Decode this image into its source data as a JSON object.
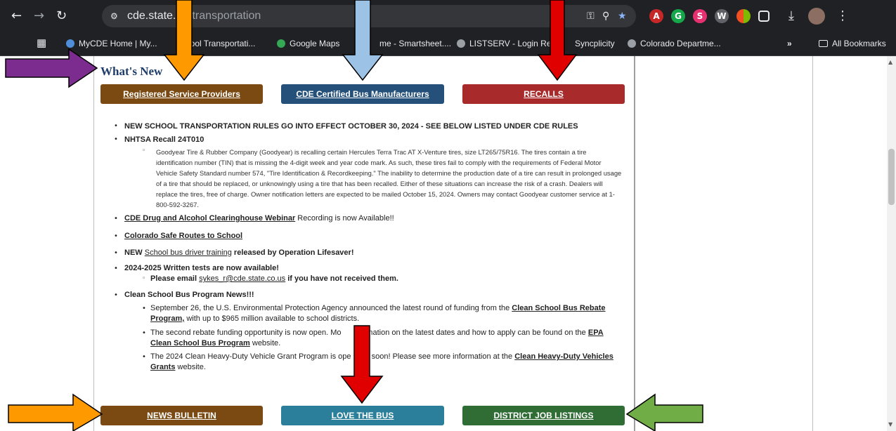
{
  "browser": {
    "url_host": "cde.state.co",
    "url_path": "/transportation",
    "bookmarks": [
      "MyCDE Home | My...",
      "chool Transportati...",
      "Google Maps",
      "me - Smartsheet....",
      "LISTSERV - Login Re...",
      "Syncplicity",
      "Colorado Departme..."
    ],
    "more_label": "»",
    "all_bookmarks": "All Bookmarks"
  },
  "section": {
    "title": "What's New"
  },
  "top_buttons": {
    "service_providers": "Registered Service Providers",
    "bus_manufacturers": "CDE Certified Bus Manufacturers",
    "recalls": "RECALLS"
  },
  "news": {
    "item1": "NEW SCHOOL TRANSPORTATION RULES GO INTO EFFECT OCTOBER 30, 2024 - SEE BELOW LISTED UNDER CDE RULES",
    "item2_title": "NHTSA Recall 24T010",
    "recall_text": "Goodyear Tire & Rubber Company (Goodyear) is recalling certain Hercules Terra Trac AT X-Venture tires, size LT265/75R16. The tires contain a tire identification number (TIN) that is missing the 4-digit week and year code mark. As such, these tires fail to comply with the requirements of Federal Motor Vehicle Safety Standard number 574, \"Tire Identification & Recordkeeping.\" The inability to determine the production date of a tire can result in prolonged usage of a tire that should be replaced, or unknowingly using a tire that has been recalled. Either of these situations can increase the risk of a crash. Dealers will replace the tires, free of charge. Owner notification letters are expected to be mailed October 15, 2024. Owners may contact Goodyear customer service at 1-800-592-3267.",
    "item3_link": "CDE Drug and Alcohol Clearinghouse Webinar",
    "item3_rest": " Recording is now Available!!",
    "item4_link": "Colorado Safe Routes to School",
    "item5_pre": "NEW ",
    "item5_link": "School bus driver training",
    "item5_rest": " released by Operation Lifesaver!",
    "item6": "2024-2025 Written tests are now available!",
    "item6_sub_pre": "Please email ",
    "item6_sub_link": "sykes_r@cde.state.co.us",
    "item6_sub_rest": " if you have not received them.",
    "item7": "Clean School Bus Program News!!!",
    "csb1_pre": "September 26, the U.S. Environmental Protection Agency announced the latest round of funding from the ",
    "csb1_link_a": "Clean School Bus Rebate",
    "csb1_link_b": "Program,",
    "csb1_rest": " with up to $965 million available to school districts.",
    "csb2_pre": "The second rebate funding opportunity is now open. Mo",
    "csb2_mid": "ormation on the latest dates and how to apply can be found on the ",
    "csb2_link_a": "EPA",
    "csb2_link_b": "Clean School Bus Program",
    "csb2_rest": " website.",
    "csb3_pre": "The 2024 Clean Heavy-Duty Vehicle Grant Program is ope",
    "csb3_mid": " soon! Please see more information at the ",
    "csb3_link_a": "Clean Heavy-Duty Vehicles",
    "csb3_link_b": "Grants",
    "csb3_rest": " website."
  },
  "bottom_buttons": {
    "news_bulletin": "NEWS BULLETIN",
    "love_the_bus": "LOVE THE BUS",
    "district_jobs": "DISTRICT JOB LISTINGS"
  },
  "colors": {
    "brown": "#7a4a12",
    "navy": "#24507a",
    "red": "#a82a2a",
    "teal": "#2b7f9b",
    "green": "#2f6d35",
    "arrow_orange": "#ff9900",
    "arrow_blue": "#9cc3e6",
    "arrow_red": "#e00000",
    "arrow_purple": "#7b2c8e",
    "arrow_green": "#70ad47"
  }
}
